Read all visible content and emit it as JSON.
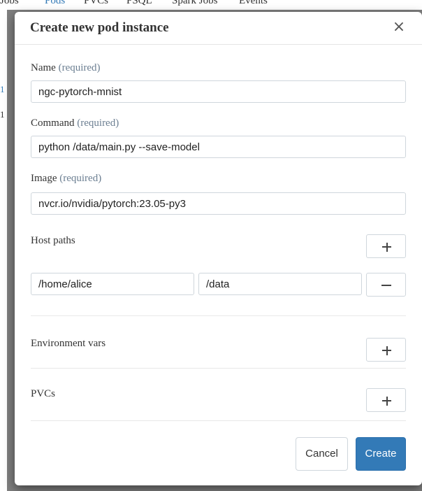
{
  "background": {
    "nav_items": [
      "Jobs",
      "Pods",
      "PVCs",
      "PSQL",
      "Spark Jobs",
      "Events"
    ],
    "active_nav": "Pods",
    "side_markers": [
      "1",
      "1"
    ]
  },
  "modal": {
    "title": "Create new pod instance",
    "close_symbol": "×",
    "fields": {
      "name": {
        "label": "Name",
        "required_text": "(required)",
        "value": "ngc-pytorch-mnist"
      },
      "command": {
        "label": "Command",
        "required_text": "(required)",
        "value": "python /data/main.py --save-model"
      },
      "image": {
        "label": "Image",
        "required_text": "(required)",
        "value": "nvcr.io/nvidia/pytorch:23.05-py3"
      }
    },
    "host_paths": {
      "label": "Host paths",
      "rows": [
        {
          "host": "/home/alice",
          "container": "/data"
        }
      ]
    },
    "env_vars": {
      "label": "Environment vars"
    },
    "pvcs": {
      "label": "PVCs"
    },
    "icons": {
      "add": "plus-icon",
      "remove": "minus-icon",
      "close": "close-icon"
    },
    "buttons": {
      "cancel": "Cancel",
      "create": "Create"
    },
    "colors": {
      "primary": "#337ab7",
      "required": "#6c7f92"
    }
  }
}
